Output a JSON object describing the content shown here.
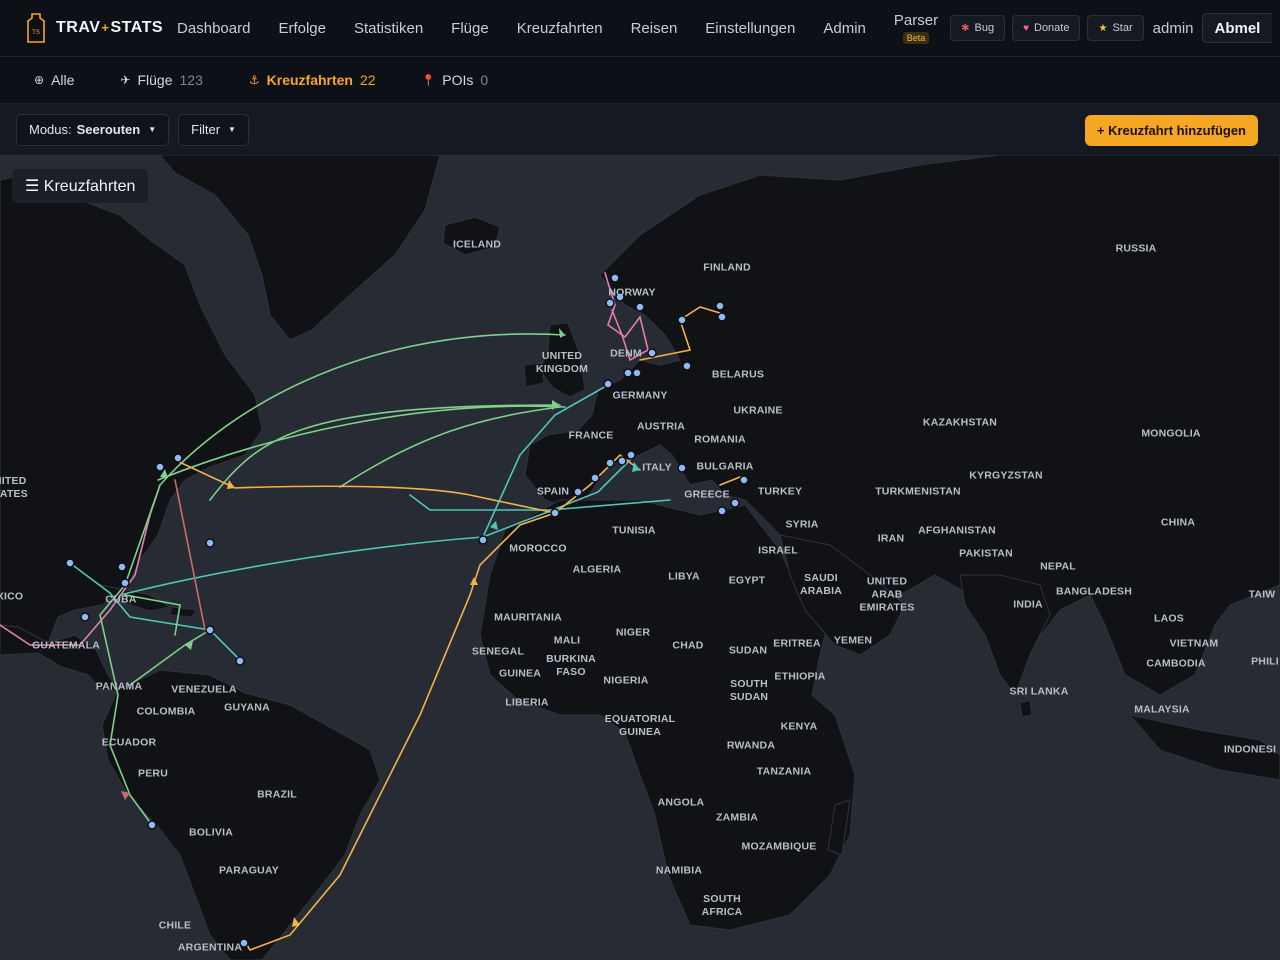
{
  "brand": {
    "name_left": "TRAV",
    "name_plus": "+",
    "name_right": "STATS",
    "badge_text": "TS"
  },
  "nav": {
    "items": [
      "Dashboard",
      "Erfolge",
      "Statistiken",
      "Flüge",
      "Kreuzfahrten",
      "Reisen",
      "Einstellungen",
      "Admin"
    ],
    "parser_label": "Parser",
    "parser_badge": "Beta"
  },
  "header_buttons": {
    "bug": "Bug",
    "donate": "Donate",
    "star": "Star"
  },
  "user": {
    "name": "admin",
    "logout_label": "Abmel"
  },
  "tabs": [
    {
      "label": "Alle",
      "count": "",
      "icon": "globe-icon",
      "glyph": "⊕"
    },
    {
      "label": "Flüge",
      "count": "123",
      "icon": "plane-icon",
      "glyph": "✈"
    },
    {
      "label": "Kreuzfahrten",
      "count": "22",
      "icon": "anchor-icon",
      "glyph": "⚓"
    },
    {
      "label": "POIs",
      "count": "0",
      "icon": "pin-icon",
      "glyph": "📍"
    }
  ],
  "toolbar": {
    "mode_prefix": "Modus:",
    "mode_value": "Seerouten",
    "filter_label": "Filter",
    "add_label": "+ Kreuzfahrt hinzufügen"
  },
  "map": {
    "panel_label": "☰ Kreuzfahrten",
    "labels": [
      "ICELAND",
      "FINLAND",
      "RUSSIA",
      "NORWAY",
      "UNITED KINGDOM",
      "DENM",
      "BELARUS",
      "GERMANY",
      "UKRAINE",
      "FRANCE",
      "AUSTRIA",
      "ROMANIA",
      "KAZAKHSTAN",
      "MONGOLIA",
      "BULGARIA",
      "ITALY",
      "SPAIN",
      "GREECE",
      "TURKEY",
      "TURKMENISTAN",
      "KYRGYZSTAN",
      "NITED TATES",
      "TUNISIA",
      "SYRIA",
      "AFGHANISTAN",
      "CHINA",
      "MOROCCO",
      "IRAN",
      "ISRAEL",
      "PAKISTAN",
      "ALGERIA",
      "LIBYA",
      "EGYPT",
      "SAUDI ARABIA",
      "UNITED ARAB EMIRATES",
      "NEPAL",
      "BANGLADESH",
      "TAIW",
      "XICO",
      "CUBA",
      "INDIA",
      "MAURITANIA",
      "LAOS",
      "MALI",
      "NIGER",
      "CHAD",
      "ERITREA",
      "YEMEN",
      "SUDAN",
      "GUATEMALA",
      "SENEGAL",
      "BURKINA FASO",
      "GUINEA",
      "VIETNAM",
      "CAMBODIA",
      "PHILI",
      "PANAMA",
      "VENEZUELA",
      "NIGERIA",
      "SOUTH SUDAN",
      "ETHIOPIA",
      "SRI LANKA",
      "LIBERIA",
      "GUYANA",
      "COLOMBIA",
      "MALAYSIA",
      "EQUATORIAL GUINEA",
      "KENYA",
      "ECUADOR",
      "INDONESI",
      "RWANDA",
      "PERU",
      "TANZANIA",
      "BRAZIL",
      "ANGOLA",
      "ZAMBIA",
      "BOLIVIA",
      "MOZAMBIQUE",
      "NAMIBIA",
      "PARAGUAY",
      "SOUTH AFRICA",
      "CHILE",
      "ARGENTINA"
    ],
    "route_colors": {
      "green": "#7fd08a",
      "teal": "#4fc7b4",
      "orange": "#f2b34c",
      "pink": "#e07fb0",
      "red": "#c96b6b"
    },
    "colors": {
      "ocean": "#272b33",
      "land": "#101216",
      "border": "#2f333b",
      "port": "#8fb8f5"
    }
  }
}
